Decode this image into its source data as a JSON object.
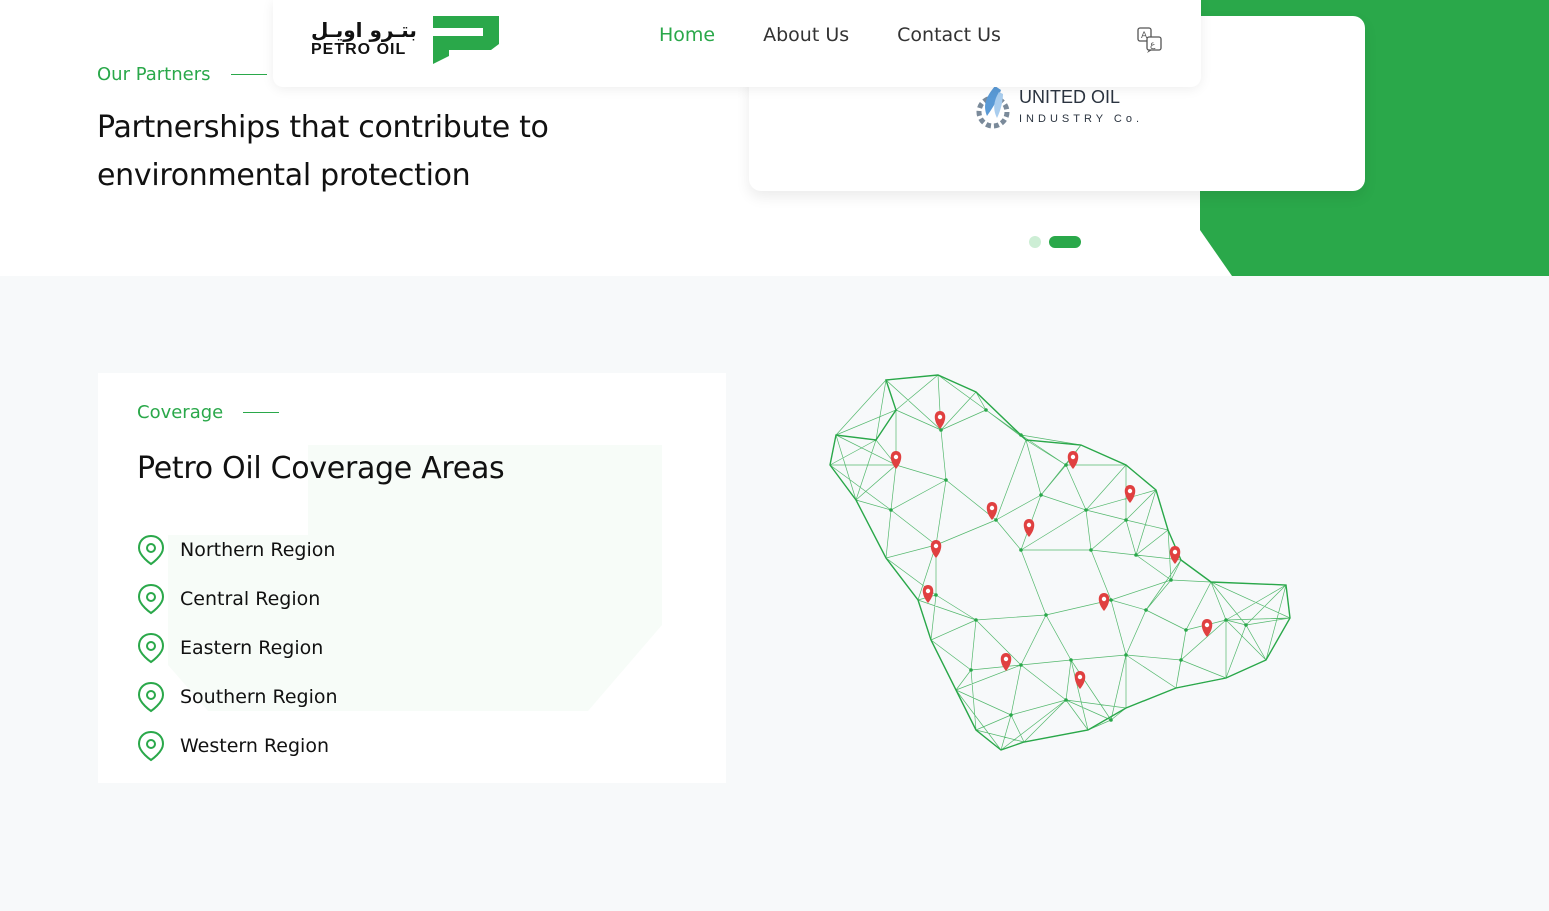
{
  "brand": {
    "arabic": "بتـرو اويـل",
    "english": "PETRO OIL",
    "green": "#2aa84a"
  },
  "nav": {
    "home": "Home",
    "about": "About Us",
    "contact": "Contact Us",
    "language_icon": "translate-icon"
  },
  "partners": {
    "eyebrow": "Our Partners",
    "heading": "Partnerships that contribute to environmental protection",
    "partner": {
      "name": "UNITED OIL",
      "sub": "INDUSTRY Co."
    },
    "slides": 2,
    "active_slide": 2
  },
  "coverage": {
    "eyebrow": "Coverage",
    "heading": "Petro Oil Coverage Areas",
    "regions": [
      "Northern Region",
      "Central Region",
      "Eastern Region",
      "Southern Region",
      "Western Region"
    ],
    "marker_icon": "location-pin-icon",
    "marker_color": "#e04040"
  }
}
